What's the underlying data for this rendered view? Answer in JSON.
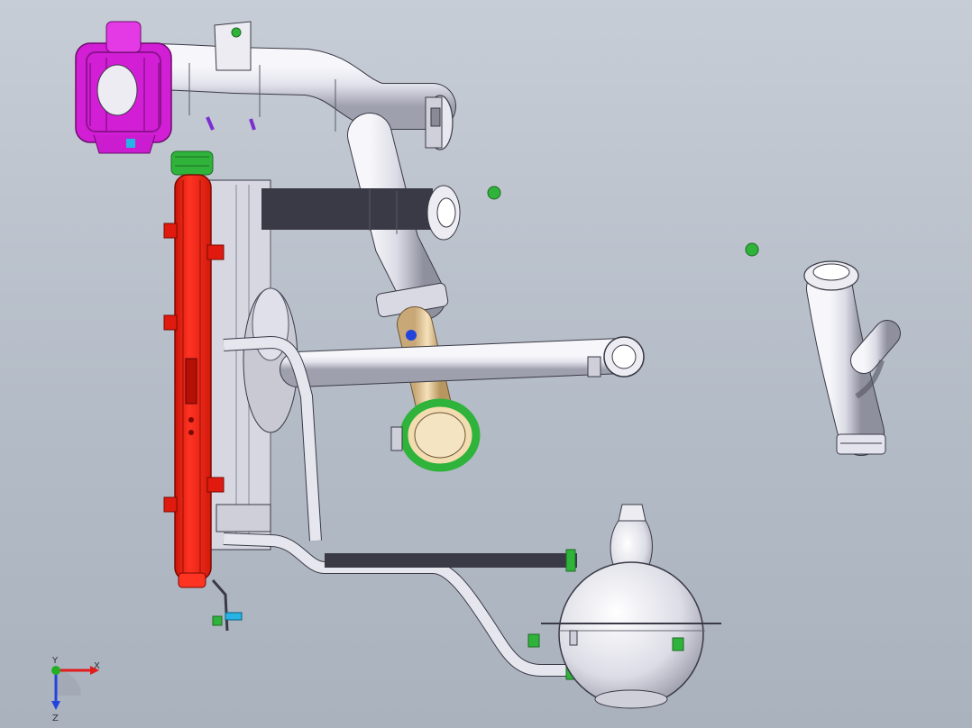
{
  "viewport": {
    "background_top": "#c7cdd6",
    "background_bottom": "#aab2be"
  },
  "colors": {
    "pipe": "#e4e4ee",
    "pipe_edge": "#3a3a46",
    "radiator_tank": "#ff2a1a",
    "reservoir_cap": "#d21fd6",
    "clamp_green": "#2fb33a",
    "hose_tan": "#f0d6a8",
    "axis_x": "#e21b1b",
    "axis_y": "#22b022",
    "axis_z": "#2244dd"
  },
  "triad": {
    "x_label": "X",
    "y_label": "Y",
    "z_label": "Z"
  },
  "components": [
    "coolant-filler-cap",
    "upper-radiator-hose",
    "radiator",
    "cooling-fan",
    "intermediate-hose",
    "lower-radiator-hose",
    "expansion-tank",
    "thermostat-outlet-hose",
    "bleed-line"
  ]
}
